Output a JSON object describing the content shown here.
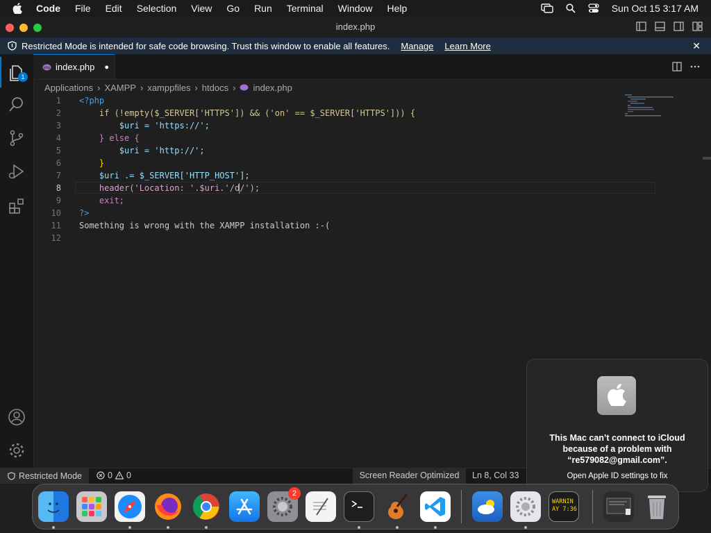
{
  "menubar": {
    "app": "Code",
    "items": [
      "File",
      "Edit",
      "Selection",
      "View",
      "Go",
      "Run",
      "Terminal",
      "Window",
      "Help"
    ],
    "datetime": "Sun Oct 15  3:17 AM"
  },
  "window": {
    "title": "index.php"
  },
  "banner": {
    "text": "Restricted Mode is intended for safe code browsing. Trust this window to enable all features.",
    "manage": "Manage",
    "learn_more": "Learn More",
    "close": "✕"
  },
  "activity": {
    "explorer_badge": "1"
  },
  "tab": {
    "label": "index.php",
    "modified": "●"
  },
  "breadcrumb": [
    "Applications",
    "XAMPP",
    "xamppfiles",
    "htdocs",
    "index.php"
  ],
  "editor": {
    "line_numbers": [
      "1",
      "2",
      "3",
      "4",
      "5",
      "6",
      "7",
      "8",
      "9",
      "10",
      "11",
      "12"
    ],
    "lines": [
      "<?php",
      "    if (!empty($_SERVER['HTTPS']) && ('on' == $_SERVER['HTTPS'])) {",
      "        $uri = 'https://';",
      "    } else {",
      "        $uri = 'http://';",
      "    }",
      "    $uri .= $_SERVER['HTTP_HOST'];",
      "    header('Location: '.$uri.'/d/');",
      "    exit;",
      "?>",
      "Something is wrong with the XAMPP installation :-(",
      ""
    ]
  },
  "statusbar": {
    "mode": "Restricted Mode",
    "errors": "0",
    "warnings": "0",
    "screen_reader": "Screen Reader Optimized",
    "position": "Ln 8, Col 33"
  },
  "notification": {
    "message": "This Mac can’t connect to iCloud because of a problem with “re579082@gmail.com”.",
    "action": "Open Apple ID settings to fix"
  },
  "dock": {
    "settings_badge": "2",
    "console_text": "WARNIN\nAY 7:36"
  },
  "colors": {
    "accent": "#0078d4",
    "banner_bg": "#1f2e3e",
    "editor_bg": "#1f1f1f"
  }
}
